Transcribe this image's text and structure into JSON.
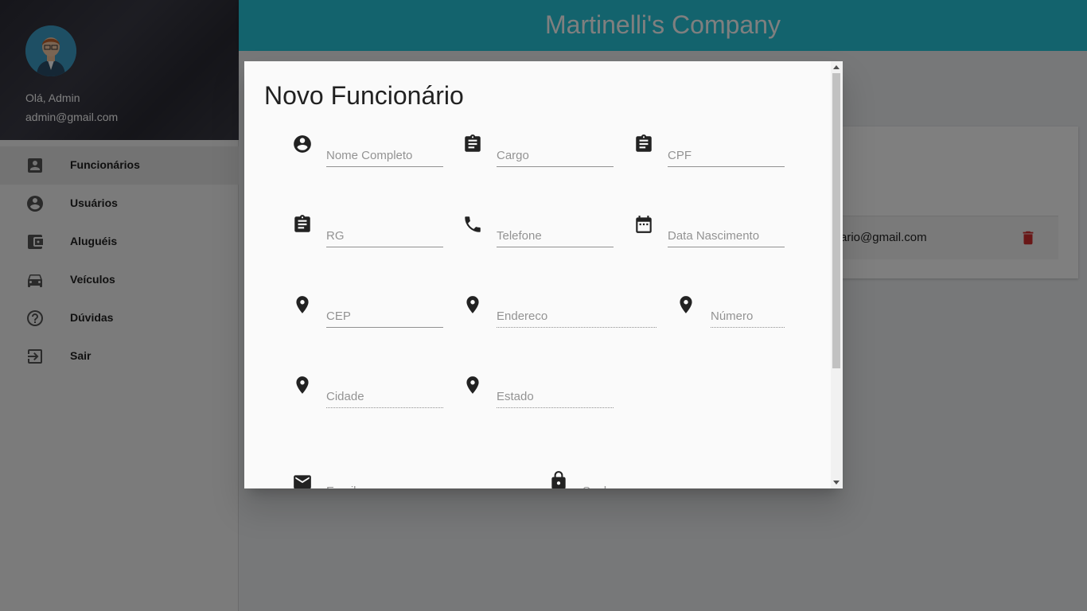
{
  "sidebar": {
    "greeting": "Olá, Admin",
    "email": "admin@gmail.com",
    "items": [
      {
        "label": "Funcionários",
        "icon": "contact-badge-icon"
      },
      {
        "label": "Usuários",
        "icon": "account-circle-icon"
      },
      {
        "label": "Aluguéis",
        "icon": "wallet-icon"
      },
      {
        "label": "Veículos",
        "icon": "car-icon"
      },
      {
        "label": "Dúvidas",
        "icon": "help-icon"
      },
      {
        "label": "Sair",
        "icon": "logout-icon"
      }
    ]
  },
  "header": {
    "title": "Martinelli's Company"
  },
  "list": {
    "row_email": "ario@gmail.com"
  },
  "dialog": {
    "title": "Novo Funcionário",
    "fields": {
      "nome": "Nome Completo",
      "cargo": "Cargo",
      "cpf": "CPF",
      "rg": "RG",
      "telefone": "Telefone",
      "data_nascimento": "Data Nascimento",
      "cep": "CEP",
      "endereco": "Endereco",
      "numero": "Número",
      "cidade": "Cidade",
      "estado": "Estado",
      "email": "Email",
      "senha": "Senha"
    }
  },
  "colors": {
    "accent": "#26c6da",
    "danger": "#d32f2f"
  }
}
